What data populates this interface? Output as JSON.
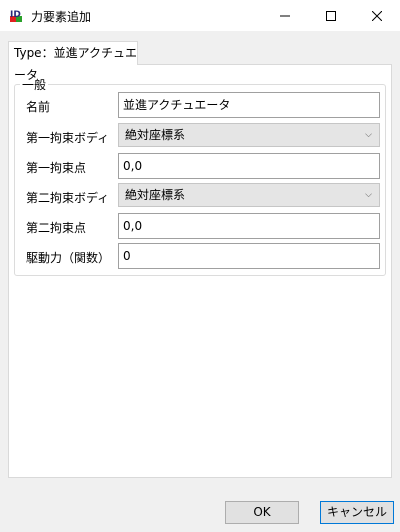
{
  "window": {
    "title": "力要素追加",
    "minimize_symbol": "—",
    "maximize_symbol": "☐",
    "close_symbol": "✕"
  },
  "tab": {
    "label": "Type：並進アクチュエータ"
  },
  "group": {
    "title": "一般"
  },
  "form": {
    "rows": [
      {
        "label": "名前",
        "value": "並進アクチュエータ",
        "kind": "text"
      },
      {
        "label": "第一拘束ボディ",
        "value": "絶対座標系",
        "kind": "combo"
      },
      {
        "label": "第一拘束点",
        "value": "0,0",
        "kind": "text"
      },
      {
        "label": "第二拘束ボディ",
        "value": "絶対座標系",
        "kind": "combo"
      },
      {
        "label": "第二拘束点",
        "value": "0,0",
        "kind": "text"
      },
      {
        "label": "駆動力（関数）",
        "value": "0",
        "kind": "text"
      }
    ]
  },
  "buttons": {
    "ok": "OK",
    "cancel": "キャンセル"
  },
  "icons": {
    "app": "app-logo-icon",
    "combo_arrow": "chevron-down-icon"
  },
  "colors": {
    "titlebar": "#ffffff",
    "panel": "#ffffff",
    "dialog_bg": "#f0f0f0",
    "combo_bg": "#e5e5e5",
    "focus_border": "#0078d7"
  }
}
